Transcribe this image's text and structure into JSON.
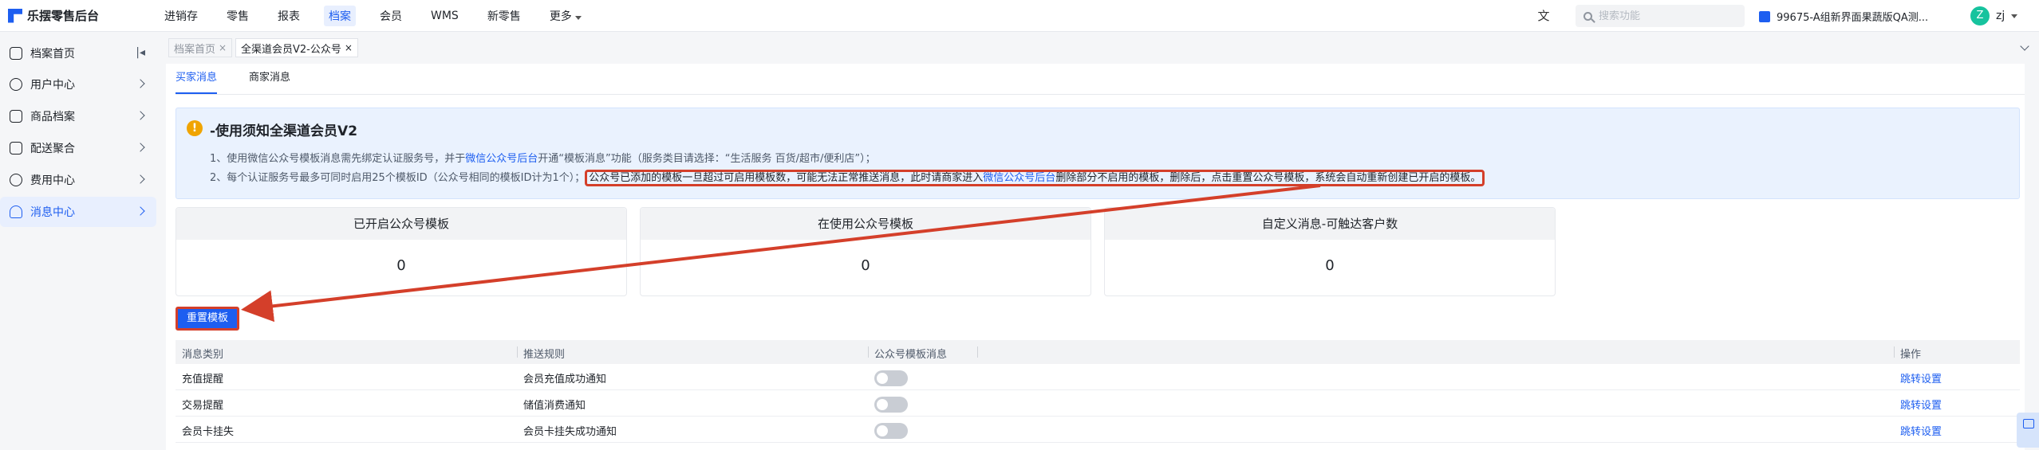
{
  "app": {
    "title": "乐摆零售后台"
  },
  "nav": {
    "items": [
      "进销存",
      "零售",
      "报表",
      "档案",
      "会员",
      "WMS",
      "新零售",
      "更多"
    ],
    "active": "档案"
  },
  "search": {
    "placeholder": "搜索功能"
  },
  "store": {
    "name": "99675-A组新界面果蔬版QA测..."
  },
  "user": {
    "initial": "Z",
    "name": "zj"
  },
  "sidebar": {
    "items": [
      {
        "label": "档案首页",
        "icon": "home-icon"
      },
      {
        "label": "用户中心",
        "icon": "user-icon"
      },
      {
        "label": "商品档案",
        "icon": "goods-icon"
      },
      {
        "label": "配送聚合",
        "icon": "delivery-icon"
      },
      {
        "label": "费用中心",
        "icon": "fee-icon"
      },
      {
        "label": "消息中心",
        "icon": "bell-icon",
        "active": true
      }
    ]
  },
  "tabs": [
    {
      "label": "档案首页",
      "close": "×"
    },
    {
      "label": "全渠道会员V2-公众号",
      "close": "×",
      "current": true
    }
  ],
  "subtabs": [
    "买家消息",
    "商家消息"
  ],
  "notice": {
    "title": "-使用须知全渠道会员V2",
    "line1_a": "1、使用微信公众号模板消息需先绑定认证服务号，并于",
    "line1_link": "微信公众号后台",
    "line1_b": "开通“模板消息”功能（服务类目请选择：“生活服务 百货/超市/便利店”）；",
    "line2_a": "2、每个认证服务号最多可同时启用25个模板ID（公众号相同的模板ID计为1个）；",
    "line2_hl_a": "公众号已添加的模板一旦超过可启用模板数，可能无法正常推送消息，此时请商家进入",
    "line2_hl_link": "微信公众号后台",
    "line2_hl_b": "删除部分不启用的模板，删除后，点击重置公众号模板，系统会自动重新创建已开启的模板。"
  },
  "stats": [
    {
      "label": "已开启公众号模板",
      "value": "0"
    },
    {
      "label": "在使用公众号模板",
      "value": "0"
    },
    {
      "label": "自定义消息-可触达客户数",
      "value": "0"
    }
  ],
  "reset_button": "重置模板",
  "table": {
    "headers": [
      "消息类别",
      "推送规则",
      "公众号模板消息",
      "操作"
    ],
    "rows": [
      {
        "category": "充值提醒",
        "rule": "会员充值成功通知",
        "enabled": false,
        "action": "跳转设置"
      },
      {
        "category": "交易提醒",
        "rule": "储值消费通知",
        "enabled": false,
        "action": "跳转设置"
      },
      {
        "category": "会员卡挂失",
        "rule": "会员卡挂失成功通知",
        "enabled": false,
        "action": "跳转设置"
      }
    ]
  },
  "colors": {
    "accent": "#1d5ef0",
    "highlight": "#d43f2a",
    "warning": "#f0a400"
  }
}
